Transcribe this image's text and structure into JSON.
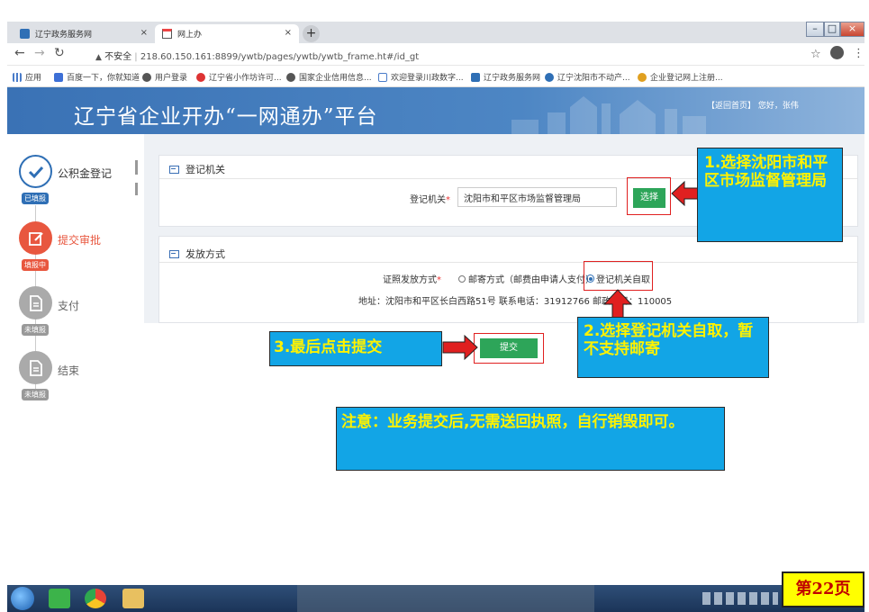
{
  "browser": {
    "tabs": [
      {
        "label": "辽宁政务服务网",
        "active": false
      },
      {
        "label": "网上办",
        "active": true
      }
    ],
    "new_tab_symbol": "+",
    "window_controls": [
      "–",
      "□",
      "×"
    ],
    "security_label": "不安全",
    "url": "218.60.150.161:8899/ywtb/pages/ywtb/ywtb_frame.ht#/id_gt",
    "bookmarks": [
      "应用",
      "百度一下，你就知道",
      "用户登录",
      "辽宁省小作坊许可...",
      "国家企业信用信息...",
      "欢迎登录川政数字...",
      "辽宁政务服务网",
      "辽宁沈阳市不动产...",
      "企业登记网上注册..."
    ]
  },
  "header": {
    "title": "辽宁省企业开办“一网通办”平台",
    "links": "【返回首页】 您好，张伟"
  },
  "steps": [
    {
      "label": "公积金登记",
      "badge": "已填报",
      "state": "done"
    },
    {
      "label": "提交审批",
      "badge": "填报中",
      "state": "active"
    },
    {
      "label": "支付",
      "badge": "未填报",
      "state": "pending"
    },
    {
      "label": "结束",
      "badge": "未填报",
      "state": "pending"
    }
  ],
  "section_registration": {
    "title": "登记机关",
    "field_label": "登记机关",
    "required_mark": "*",
    "field_value": "沈阳市和平区市场监督管理局",
    "select_button": "选择"
  },
  "section_delivery": {
    "title": "发放方式",
    "field_label": "证照发放方式",
    "required_mark": "*",
    "options": [
      {
        "label": "邮寄方式（邮费由申请人支付）",
        "selected": false
      },
      {
        "label": "登记机关自取",
        "selected": true
      }
    ],
    "address_text": "地址：沈阳市和平区长白西路51号  联系电话：31912766  邮政编码：110005"
  },
  "submit_button": "提交",
  "annotations": {
    "callout1": "1.选择沈阳市和平区市场监督管理局",
    "callout2": "2.选择登记机关自取，暂不支持邮寄",
    "callout3": "3.最后点击提交",
    "note": "注意：业务提交后,无需送回执照，自行销毁即可。"
  },
  "page_badge": "第22页",
  "colors": {
    "header_blue": "#3a72b5",
    "green_button": "#2da559",
    "step_done": "#2f6fb5",
    "step_active": "#e8573f",
    "step_pending": "#999999",
    "callout_bg": "#12a5e6",
    "callout_text": "#fff200",
    "highlight_red": "#e02020",
    "page_badge_bg": "#ffff00"
  },
  "icons": [
    "check-icon",
    "edit-icon",
    "document-icon",
    "list-icon",
    "red-arrow-icon",
    "windows-start-icon",
    "wechat-icon",
    "chrome-icon",
    "folder-icon"
  ]
}
